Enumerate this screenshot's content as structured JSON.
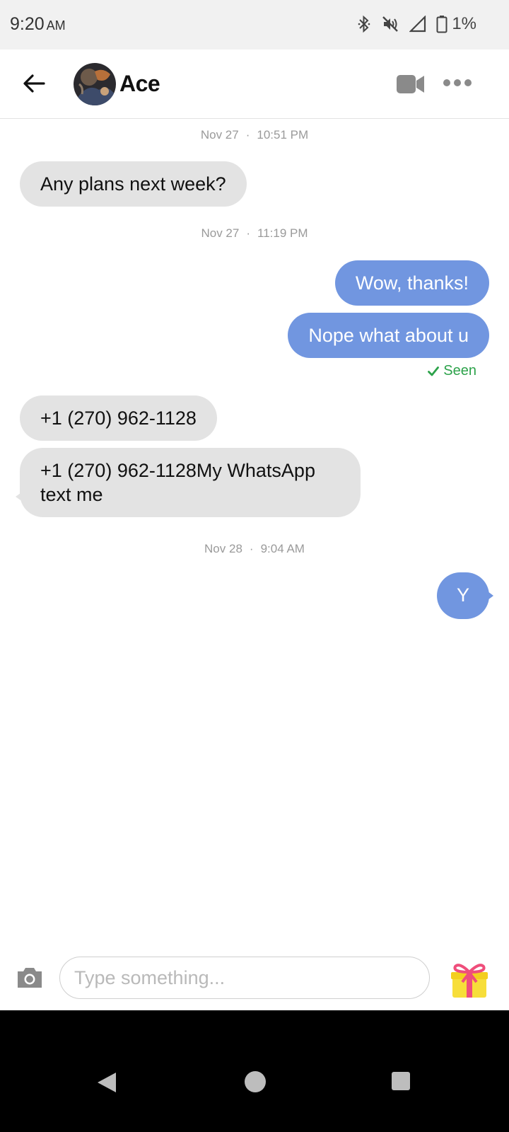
{
  "status_bar": {
    "time": "9:20",
    "ampm": "AM",
    "battery_percent": "1%",
    "icons": [
      "bluetooth-icon",
      "mute-icon",
      "signal-icon",
      "battery-icon"
    ]
  },
  "header": {
    "contact_name": "Ace",
    "icons": [
      "back-arrow-icon",
      "video-camera-icon",
      "more-options-icon"
    ]
  },
  "messages": {
    "timestamps": [
      {
        "date": "Nov 27",
        "time": "10:51 PM"
      },
      {
        "date": "Nov 27",
        "time": "11:19 PM"
      },
      {
        "date": "Nov 28",
        "time": "9:04 AM"
      }
    ],
    "items": [
      {
        "direction": "in",
        "text": "Any plans next week?"
      },
      {
        "direction": "out",
        "text": "Wow, thanks!"
      },
      {
        "direction": "out",
        "text": "Nope what about u"
      },
      {
        "direction": "in",
        "text": "+1 (270) 962-1128"
      },
      {
        "direction": "in",
        "text": "+1 (270) 962-1128My WhatsApp text me"
      },
      {
        "direction": "out",
        "text": "Y"
      }
    ],
    "seen_label": "Seen"
  },
  "input_bar": {
    "placeholder": "Type something...",
    "value": ""
  },
  "colors": {
    "outgoing_bubble": "#7196e0",
    "incoming_bubble": "#e3e3e3",
    "seen": "#2ca24a",
    "status_bar_bg": "#f1f1f1",
    "nav_bar_bg": "#000000"
  }
}
